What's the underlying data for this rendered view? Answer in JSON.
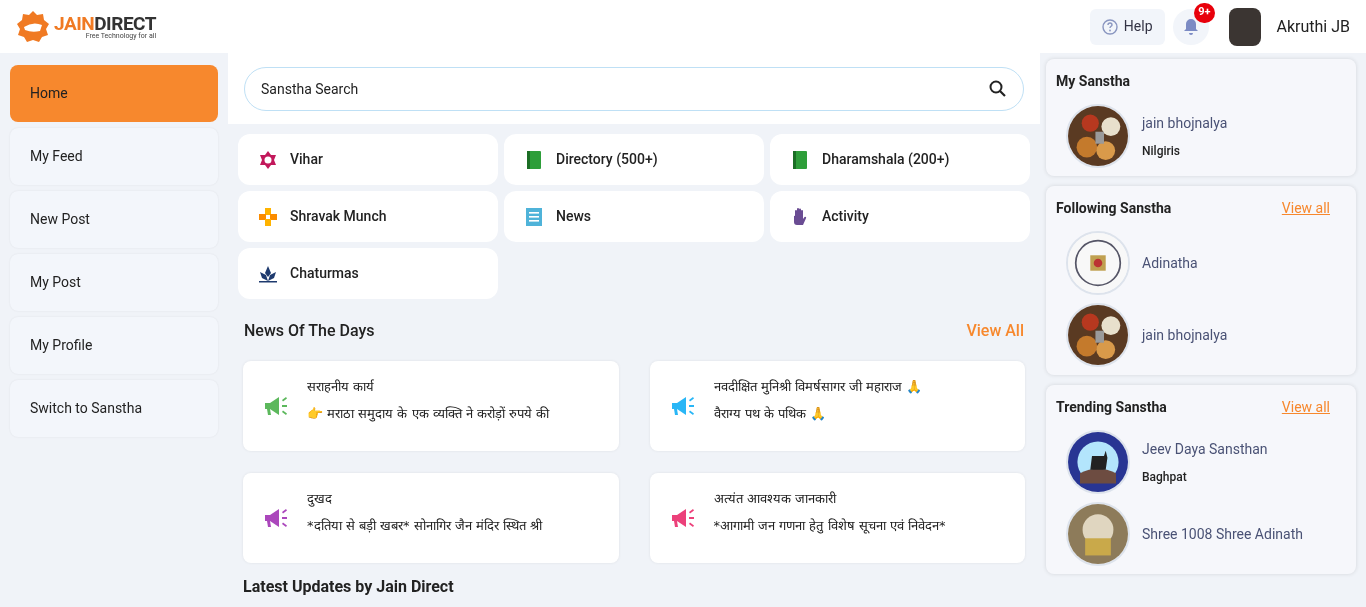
{
  "header": {
    "logo_highlight": "JAIN",
    "logo_rest": "DIRECT",
    "logo_tagline": "Free Technology for all",
    "help": "Help",
    "notification_count": "9+",
    "user_name": "Akruthi JB"
  },
  "sidebar": {
    "items": [
      {
        "label": "Home",
        "selected": true
      },
      {
        "label": "My Feed",
        "selected": false
      },
      {
        "label": "New Post",
        "selected": false
      },
      {
        "label": "My Post",
        "selected": false
      },
      {
        "label": "My Profile",
        "selected": false
      },
      {
        "label": "Switch to Sanstha",
        "selected": false
      }
    ]
  },
  "search": {
    "placeholder": "Sanstha Search"
  },
  "tiles": [
    {
      "label": "Vihar"
    },
    {
      "label": "Directory (500+)"
    },
    {
      "label": "Dharamshala (200+)"
    },
    {
      "label": "Shravak Munch"
    },
    {
      "label": "News"
    },
    {
      "label": "Activity"
    },
    {
      "label": "Chaturmas"
    }
  ],
  "news": {
    "title": "News Of The Days",
    "view_all": "View All",
    "items": [
      {
        "title": "सराहनीय कार्य",
        "text": "👉 मराठा समुदाय के एक व्यक्ति ने करोड़ों रुपये की",
        "color": "#5cb85c"
      },
      {
        "title": "नवदीक्षित मुनिश्री विमर्षसागर जी महाराज 🙏",
        "text": "वैराग्य पथ के पथिक 🙏",
        "color": "#29b6f6"
      },
      {
        "title": "दुखद",
        "text": "*दतिया से बड़ी खबर* सोनागिर जैन मंदिर स्थित श्री",
        "color": "#ab47bc"
      },
      {
        "title": "अत्यंत आवश्यक जानकारी",
        "text": "*आगामी जन गणना हेतु विशेष सूचना एवं निवेदन*",
        "color": "#ec407a"
      }
    ]
  },
  "latest_heading": "Latest Updates by Jain Direct",
  "panels": [
    {
      "title": "My Sanstha",
      "items": [
        {
          "name": "jain bhojnalya",
          "location": "Nilgiris"
        }
      ]
    },
    {
      "title": "Following Sanstha",
      "view_all": "View all",
      "items": [
        {
          "name": "Adinatha"
        },
        {
          "name": "jain bhojnalya"
        }
      ]
    },
    {
      "title": "Trending Sanstha",
      "view_all": "View all",
      "items": [
        {
          "name": "Jeev Daya Sansthan",
          "location": "Baghpat"
        },
        {
          "name": "Shree 1008 Shree Adinath"
        }
      ]
    }
  ]
}
